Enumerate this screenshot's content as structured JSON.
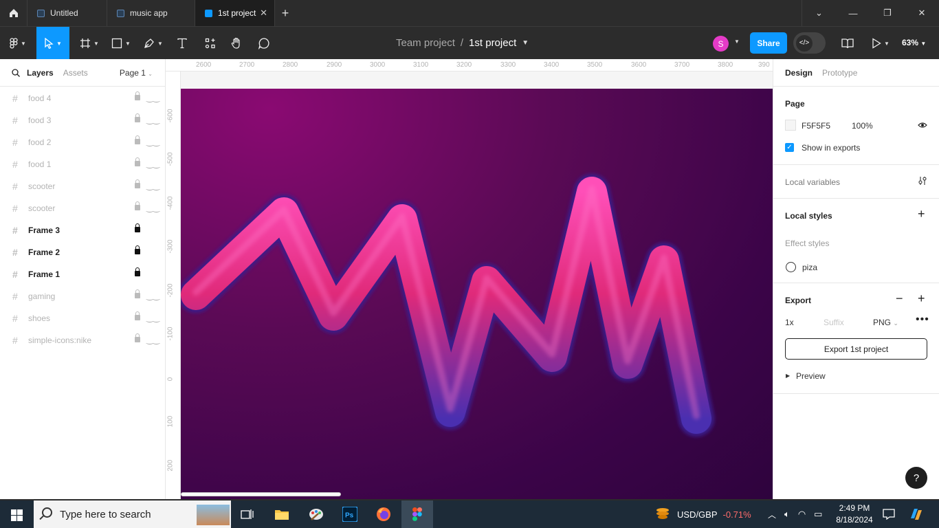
{
  "tabs": [
    {
      "label": "Untitled",
      "active": false
    },
    {
      "label": "music app",
      "active": false
    },
    {
      "label": "1st project",
      "active": true
    }
  ],
  "breadcrumb": {
    "team": "Team project",
    "separator": "/",
    "file": "1st project"
  },
  "user": {
    "initial": "S"
  },
  "toolbar": {
    "share_label": "Share",
    "zoom": "63%"
  },
  "left_panel": {
    "tab_layers": "Layers",
    "tab_assets": "Assets",
    "page_selector": "Page 1",
    "layers": [
      {
        "name": "food 4",
        "visible": false
      },
      {
        "name": "food 3",
        "visible": false
      },
      {
        "name": "food 2",
        "visible": false
      },
      {
        "name": "food 1",
        "visible": false
      },
      {
        "name": "scooter",
        "visible": false
      },
      {
        "name": "scooter",
        "visible": false
      },
      {
        "name": "Frame 3",
        "visible": true
      },
      {
        "name": "Frame 2",
        "visible": true
      },
      {
        "name": "Frame 1",
        "visible": true
      },
      {
        "name": "gaming",
        "visible": false
      },
      {
        "name": "shoes",
        "visible": false
      },
      {
        "name": "simple-icons:nike",
        "visible": false
      }
    ]
  },
  "rulers": {
    "top": [
      "2600",
      "2700",
      "2800",
      "2900",
      "3000",
      "3100",
      "3200",
      "3300",
      "3400",
      "3500",
      "3600",
      "3700",
      "3800",
      "390"
    ],
    "left": [
      "-600",
      "-500",
      "-400",
      "-300",
      "-200",
      "-100",
      "0",
      "100",
      "200"
    ]
  },
  "right_panel": {
    "tab_design": "Design",
    "tab_prototype": "Prototype",
    "page_title": "Page",
    "page_color": "F5F5F5",
    "page_opacity": "100%",
    "show_in_exports": "Show in exports",
    "local_variables": "Local variables",
    "local_styles": "Local styles",
    "effect_styles": "Effect styles",
    "effect_style_name": "piza",
    "export_title": "Export",
    "export_scale": "1x",
    "export_suffix_placeholder": "Suffix",
    "export_format": "PNG",
    "export_button": "Export 1st project",
    "preview": "Preview"
  },
  "help": "?",
  "taskbar": {
    "search_placeholder": "Type here to search",
    "ticker_label": "USD/GBP",
    "ticker_change": "-0.71%",
    "time": "2:49 PM",
    "date": "8/18/2024"
  },
  "colors": {
    "accent": "#0d99ff",
    "ticker_negative": "#ff6b6b",
    "avatar": "#e53bc7"
  }
}
